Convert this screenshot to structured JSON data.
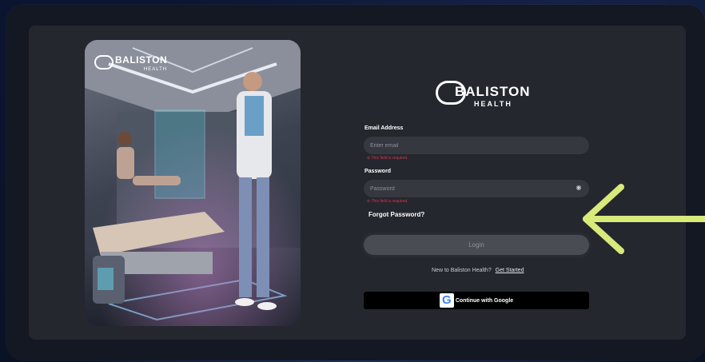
{
  "hero": {
    "logo_word": "BALISTON",
    "logo_sub": "HEALTH"
  },
  "brand": {
    "name": "BALISTON",
    "sub": "HEALTH"
  },
  "form": {
    "email_label": "Email Address",
    "email_placeholder": "Enter email",
    "email_error": "This field is required.",
    "password_label": "Password",
    "password_placeholder": "Password",
    "password_error": "This field is required.",
    "forgot": "Forgot Password?",
    "login": "Login",
    "signup_prompt": "New to Baliston Health?",
    "signup_link": "Get Started",
    "google_label": "Continue with Google",
    "google_glyph": "G"
  },
  "icons": {
    "eye": "eye-off-icon",
    "google": "google-icon",
    "arrow": "arrow-left-icon"
  },
  "colors": {
    "arrow": "#d8ea7a",
    "error": "#d6334a",
    "google_blue": "#4285F4"
  }
}
